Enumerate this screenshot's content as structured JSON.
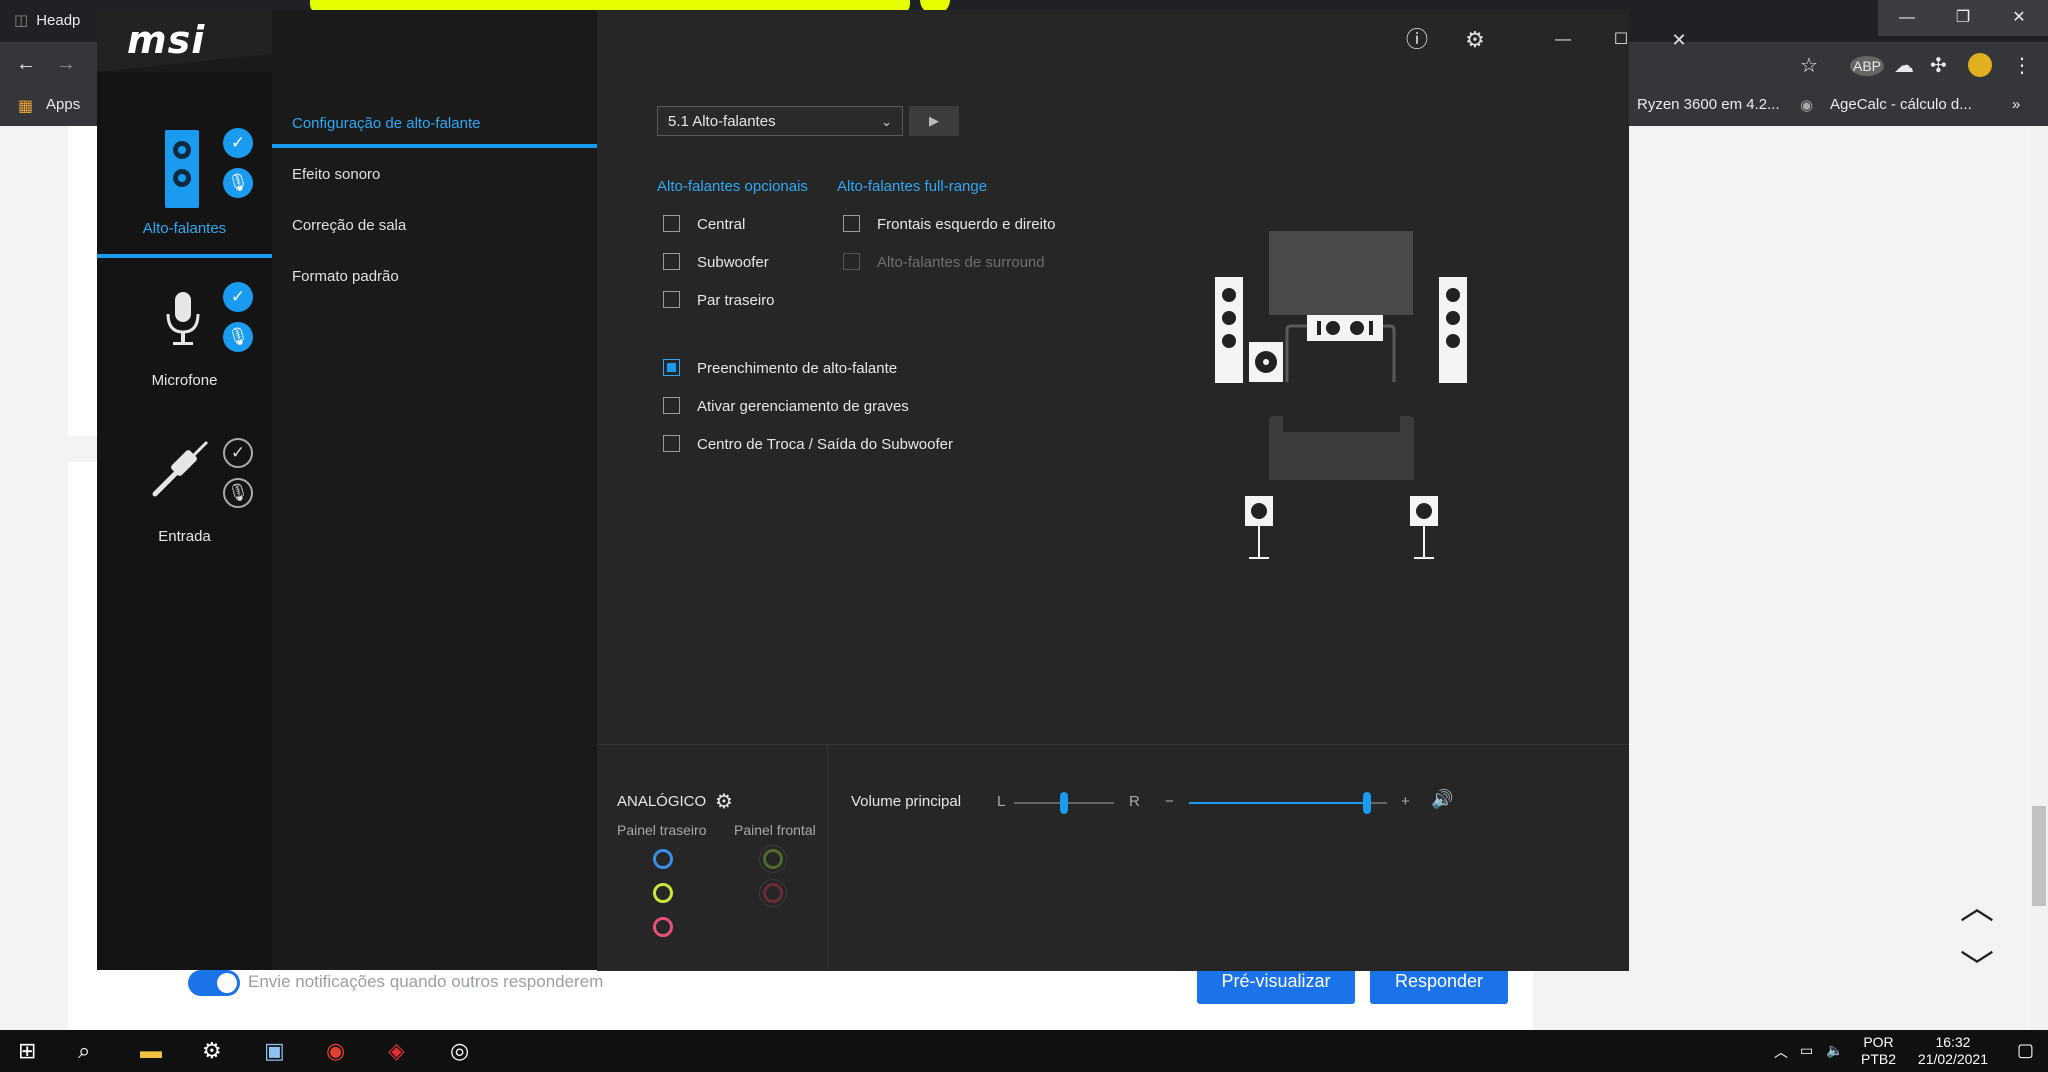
{
  "browser": {
    "tab_title": "Headp",
    "bookmarks": {
      "apps": "Apps",
      "item1": "Ryzen 3600 em 4.2...",
      "item2": "AgeCalc - cálculo d...",
      "more": "»"
    },
    "window_controls": {
      "minimize": "—",
      "maximize": "❐",
      "close": "✕"
    }
  },
  "page": {
    "notification_toggle_label": "Envie notificações quando outros responderem",
    "preview_button": "Pré-visualizar",
    "reply_button": "Responder",
    "scroll_up": "︿",
    "scroll_down": "﹀"
  },
  "app": {
    "logo": "msi",
    "devices": [
      {
        "label": "Alto-falantes",
        "selected": true
      },
      {
        "label": "Microfone",
        "selected": false
      },
      {
        "label": "Entrada",
        "selected": false
      }
    ],
    "subnav": [
      "Configuração de alto-falante",
      "Efeito sonoro",
      "Correção de sala",
      "Formato padrão"
    ],
    "speaker_config": {
      "preset": "5.1 Alto-falantes",
      "optional_heading": "Alto-falantes opcionais",
      "fullrange_heading": "Alto-falantes full-range",
      "optional": [
        {
          "label": "Central",
          "checked": false
        },
        {
          "label": "Subwoofer",
          "checked": false
        },
        {
          "label": "Par traseiro",
          "checked": false
        }
      ],
      "fullrange": [
        {
          "label": "Frontais esquerdo e direito",
          "checked": false,
          "disabled": false
        },
        {
          "label": "Alto-falantes de surround",
          "checked": false,
          "disabled": true
        }
      ],
      "extras": [
        {
          "label": "Preenchimento de alto-falante",
          "checked": true
        },
        {
          "label": "Ativar gerenciamento de graves",
          "checked": false
        },
        {
          "label": "Centro de Troca / Saída do Subwoofer",
          "checked": false
        }
      ]
    },
    "bottom": {
      "analog_title": "ANALÓGICO",
      "rear_panel": "Painel traseiro",
      "front_panel": "Painel frontal",
      "volume_label": "Volume principal",
      "balance_left": "L",
      "balance_right": "R",
      "vol_minus": "−",
      "vol_plus": "+",
      "balance_level": 0.5,
      "volume_level": 0.9,
      "rear_jacks": [
        "#3a8ee6",
        "#c8e63c",
        "#e8507a"
      ],
      "front_jacks": [
        "#4f6a2a",
        "#6a2a36"
      ]
    }
  },
  "taskbar": {
    "lang_top": "POR",
    "lang_bottom": "PTB2",
    "time": "16:32",
    "date": "21/02/2021"
  }
}
